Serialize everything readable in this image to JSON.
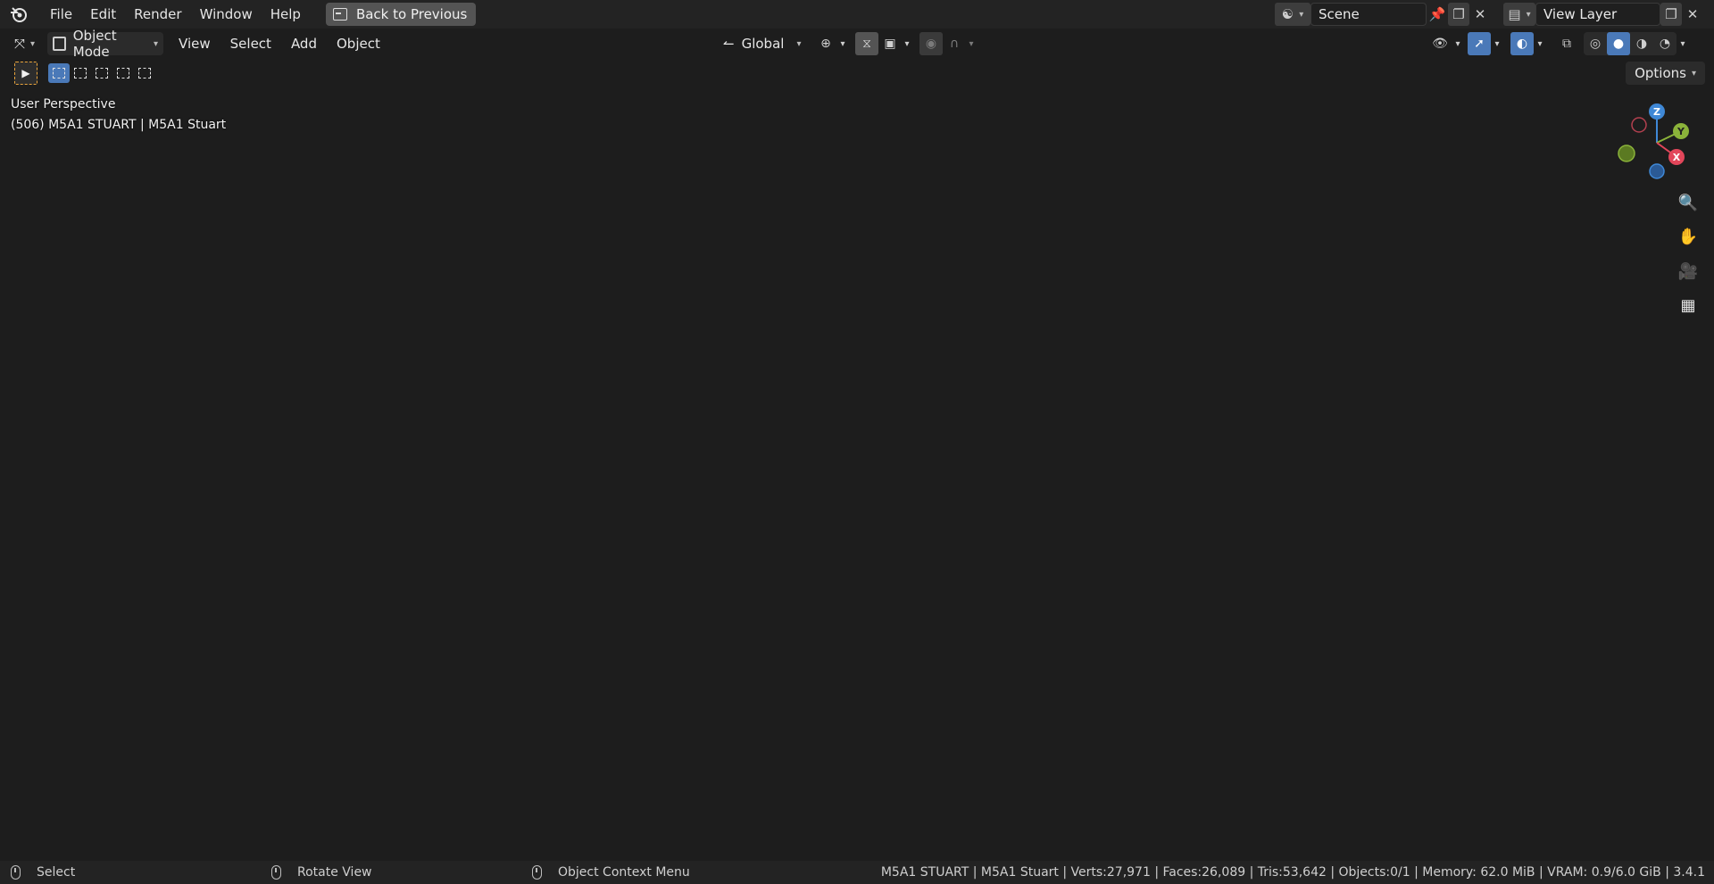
{
  "menubar": {
    "items": [
      "File",
      "Edit",
      "Render",
      "Window",
      "Help"
    ],
    "back_button": "Back to Previous",
    "scene_name": "Scene",
    "view_layer_name": "View Layer"
  },
  "header": {
    "mode": "Object Mode",
    "menus": [
      "View",
      "Select",
      "Add",
      "Object"
    ],
    "transform_orientation": "Global",
    "options": "Options"
  },
  "viewport": {
    "perspective_label": "User Perspective",
    "object_label": "(506) M5A1 STUART | M5A1 Stuart",
    "gizmo_axes": {
      "x": "X",
      "y": "Y",
      "z": "Z"
    },
    "colors": {
      "x": "#e2465a",
      "y": "#8bb33a",
      "z": "#3f88d6",
      "grid": "#474747",
      "background": "#393939"
    }
  },
  "statusbar": {
    "left_click": "Select",
    "middle_click": "Rotate View",
    "right_click": "Object Context Menu",
    "stats": "M5A1 STUART | M5A1 Stuart | Verts:27,971 | Faces:26,089 | Tris:53,642 | Objects:0/1 | Memory: 62.0 MiB | VRAM: 0.9/6.0 GiB | 3.4.1"
  }
}
